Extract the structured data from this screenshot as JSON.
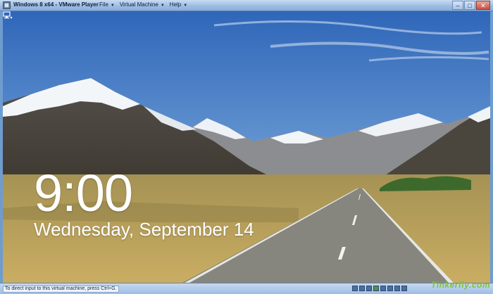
{
  "window": {
    "title": "Windows 8 x64 - VMware Player",
    "menus": [
      {
        "label": "File"
      },
      {
        "label": "Virtual Machine"
      },
      {
        "label": "Help"
      }
    ],
    "controls": {
      "minimize": "–",
      "maximize": "□",
      "close": "✕"
    }
  },
  "lockscreen": {
    "time": "9:00",
    "date": "Wednesday, September 14",
    "network_icon": "network-icon"
  },
  "statusbar": {
    "hint": "To direct input to this virtual machine, press Ctrl+G."
  },
  "watermark": "Tinkerfly.com",
  "colors": {
    "sky_top": "#2f66b8",
    "sky_bottom": "#9ec1e6",
    "grass": "#b8a15a",
    "road": "#8a8a86"
  }
}
